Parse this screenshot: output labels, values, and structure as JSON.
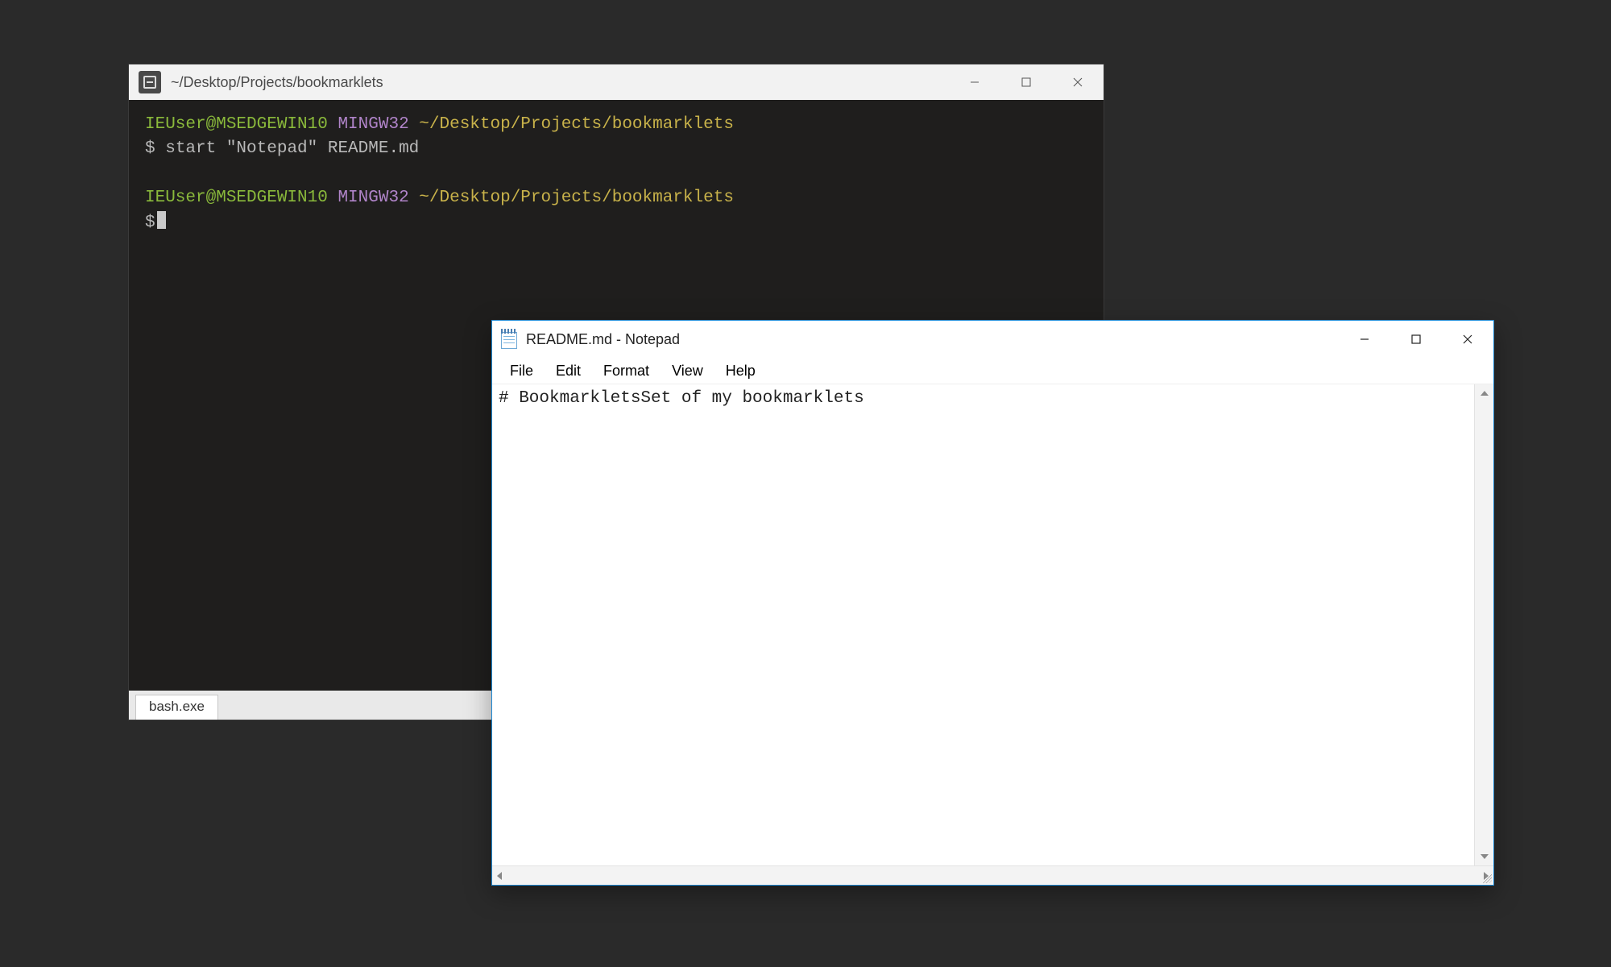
{
  "terminal": {
    "title": "~/Desktop/Projects/bookmarklets",
    "tab_label": "bash.exe",
    "prompt": {
      "user_host": "IEUser@MSEDGEWIN10",
      "env": "MINGW32",
      "path": "~/Desktop/Projects/bookmarklets",
      "symbol": "$"
    },
    "lines": {
      "cmd1": "start \"Notepad\" README.md"
    }
  },
  "notepad": {
    "title": "README.md - Notepad",
    "menu": {
      "file": "File",
      "edit": "Edit",
      "format": "Format",
      "view": "View",
      "help": "Help"
    },
    "content": "# BookmarkletsSet of my bookmarklets"
  }
}
